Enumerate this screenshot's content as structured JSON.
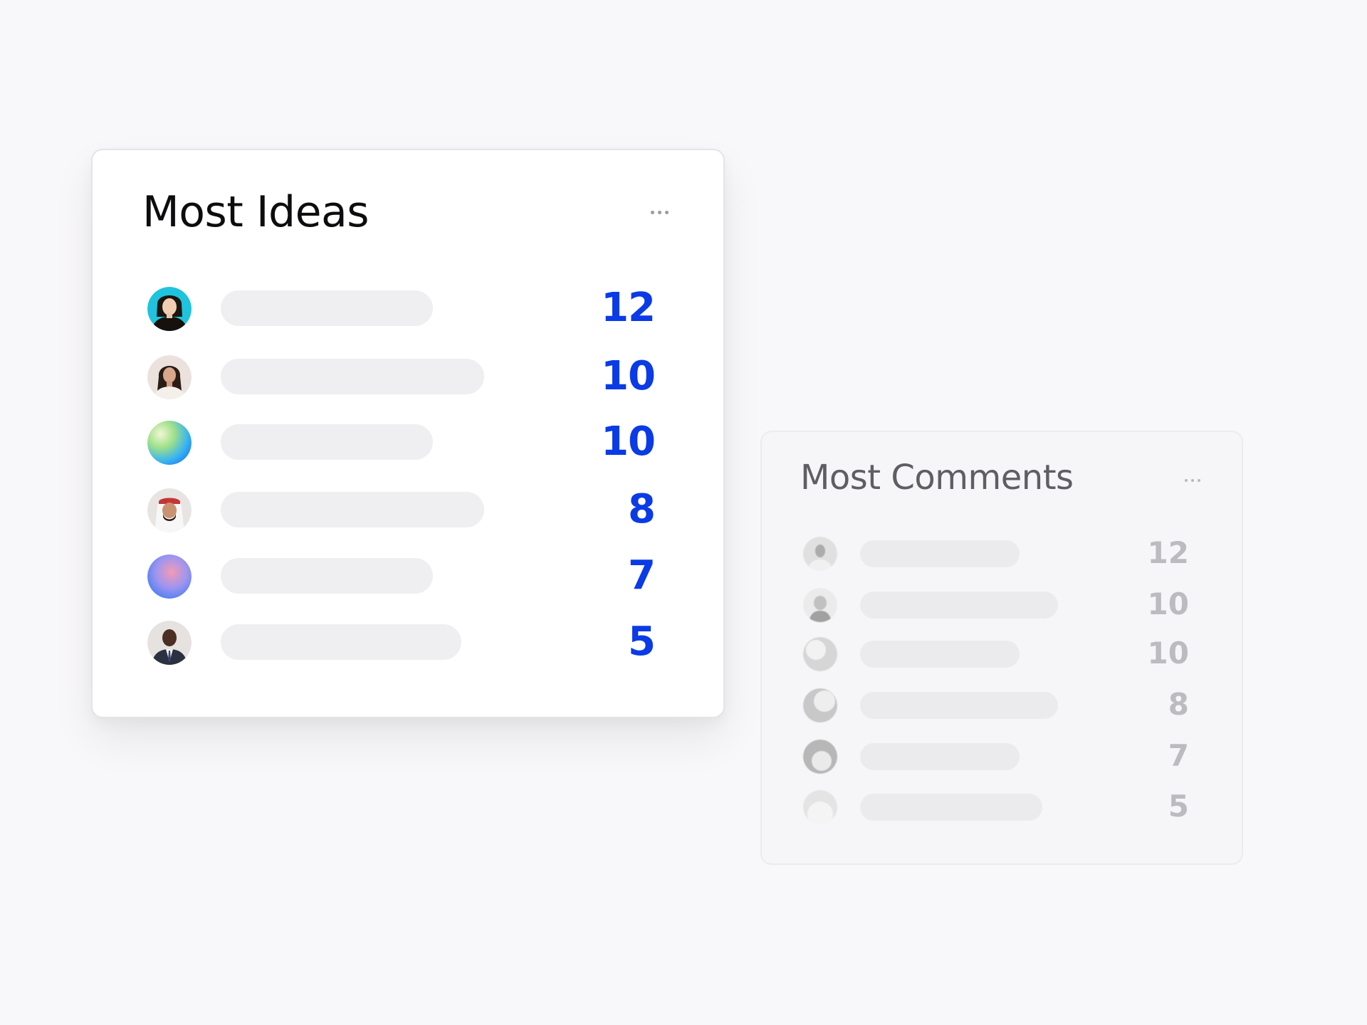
{
  "most_ideas": {
    "title": "Most Ideas",
    "rows": [
      {
        "avatar": "woman-portrait-teal-background",
        "count": "12"
      },
      {
        "avatar": "woman-portrait-dark-hair",
        "count": "10"
      },
      {
        "avatar": "gradient-placeholder-green-blue",
        "count": "10"
      },
      {
        "avatar": "man-portrait-headscarf",
        "count": "8"
      },
      {
        "avatar": "gradient-placeholder-blue-pink",
        "count": "7"
      },
      {
        "avatar": "man-portrait-suit",
        "count": "5"
      }
    ]
  },
  "most_comments": {
    "title": "Most Comments",
    "rows": [
      {
        "avatar": "person-portrait",
        "count": "12"
      },
      {
        "avatar": "man-portrait-bald",
        "count": "10"
      },
      {
        "avatar": "gradient-placeholder",
        "count": "10"
      },
      {
        "avatar": "gradient-placeholder",
        "count": "8"
      },
      {
        "avatar": "gradient-placeholder",
        "count": "7"
      },
      {
        "avatar": "gradient-placeholder",
        "count": "5"
      }
    ]
  },
  "colors": {
    "background": "#f8f7f9",
    "accent_number": "#0a3be6",
    "muted_number": "#bcbcc0",
    "placeholder_bar": "#efeef0"
  }
}
